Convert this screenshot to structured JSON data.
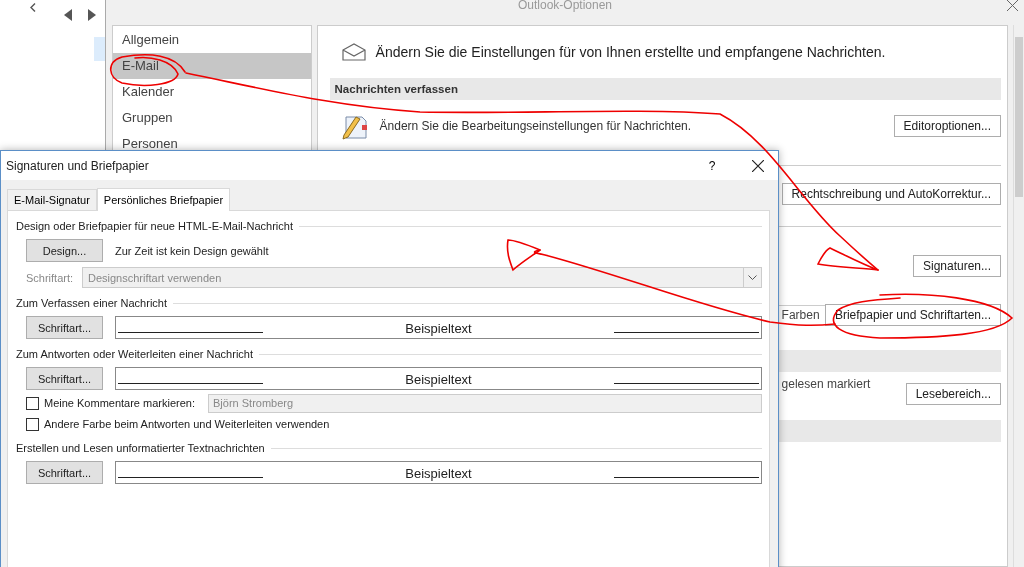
{
  "options_window": {
    "title": "Outlook-Optionen",
    "nav": [
      {
        "label": "Allgemein",
        "selected": false
      },
      {
        "label": "E-Mail",
        "selected": true
      },
      {
        "label": "Kalender",
        "selected": false
      },
      {
        "label": "Gruppen",
        "selected": false
      },
      {
        "label": "Personen",
        "selected": false
      }
    ],
    "intro": "Ändern Sie die Einstellungen für von Ihnen erstellte und empfangene Nachrichten.",
    "section": "Nachrichten verfassen",
    "editor_text": "Ändern Sie die Bearbeitungseinstellungen für Nachrichten.",
    "editor_button": "Editoroptionen...",
    "spelling_button": "Rechtschreibung und AutoKorrektur...",
    "signatures_button": "Signaturen...",
    "colors_text": "Farben",
    "stationery_button": "Briefpapier und Schriftarten...",
    "read_text": "gelesen markiert",
    "reading_pane_button": "Lesebereich..."
  },
  "dialog": {
    "title": "Signaturen und Briefpapier",
    "help": "?",
    "tabs": [
      {
        "label": "E-Mail-Signatur",
        "selected": false
      },
      {
        "label": "Persönliches Briefpapier",
        "selected": true
      }
    ],
    "design": {
      "heading": "Design oder Briefpapier für neue HTML-E-Mail-Nachricht",
      "button": "Design...",
      "status": "Zur Zeit ist kein Design gewählt",
      "font_label": "Schriftart:",
      "font_value": "Designschriftart verwenden",
      "disabled": true
    },
    "font_sections": [
      {
        "heading": "Zum Verfassen einer Nachricht",
        "button": "Schriftart...",
        "sample": "Beispieltext"
      },
      {
        "heading": "Zum Antworten oder Weiterleiten einer Nachricht",
        "button": "Schriftart...",
        "sample": "Beispieltext",
        "options": [
          {
            "label": "Meine Kommentare markieren:",
            "checked": false,
            "field": {
              "value": "Björn Stromberg",
              "disabled": true
            }
          },
          {
            "label": "Andere Farbe beim Antworten und Weiterleiten verwenden",
            "checked": false
          }
        ]
      },
      {
        "heading": "Erstellen und Lesen unformatierter Textnachrichten",
        "button": "Schriftart...",
        "sample": "Beispieltext"
      }
    ]
  }
}
